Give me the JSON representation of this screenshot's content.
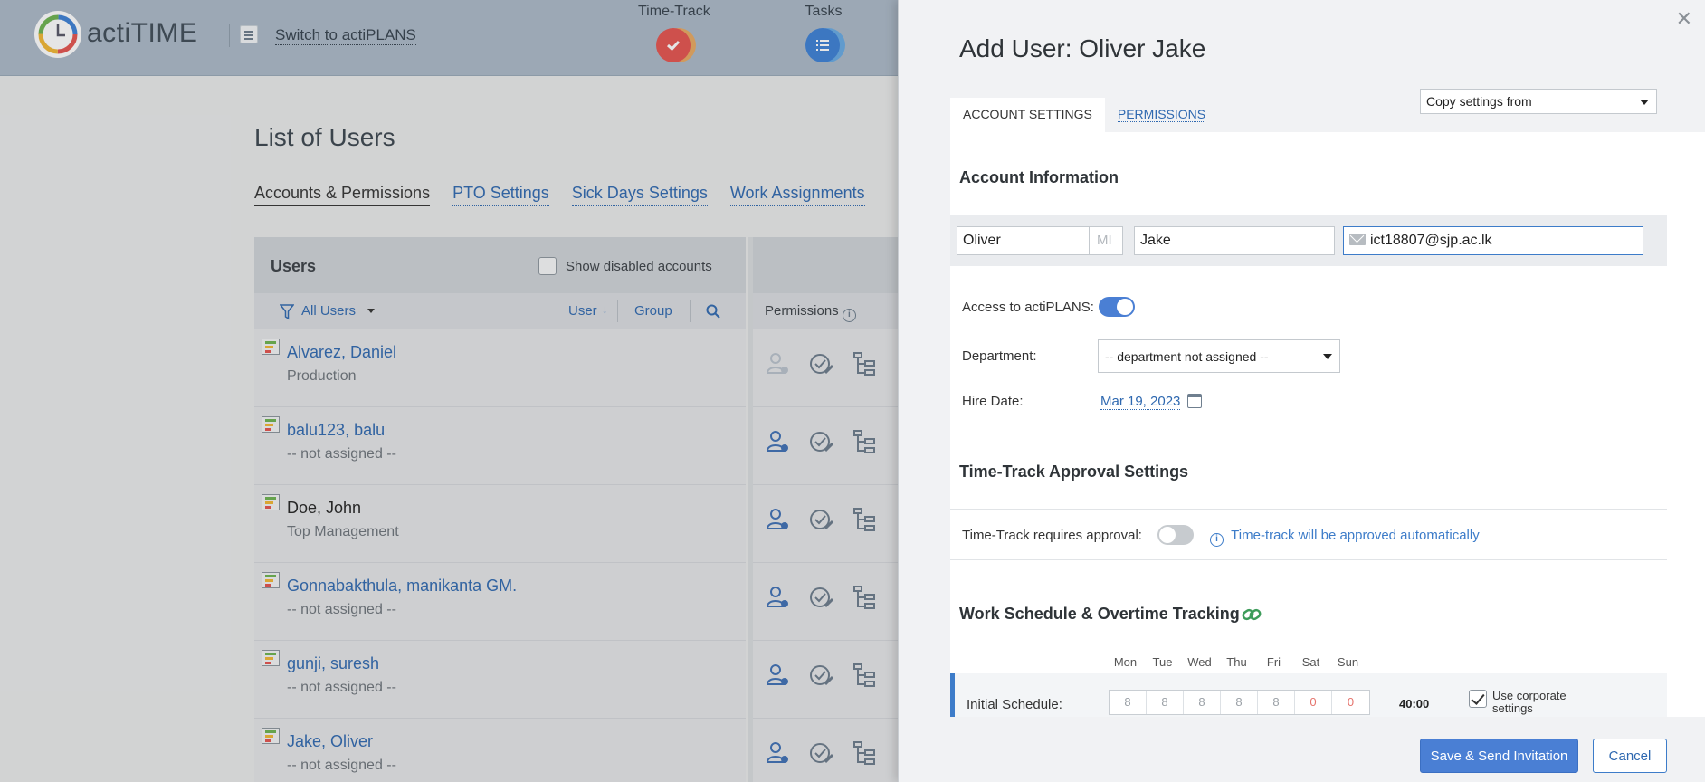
{
  "app": {
    "brand": "actiTIME",
    "switch_link": "Switch to actiPLANS",
    "nav": [
      {
        "label": "Time-Track",
        "icon": "checkmark-icon",
        "color": "#e5524d"
      },
      {
        "label": "Tasks",
        "icon": "list-icon",
        "color": "#3b7fd6"
      }
    ]
  },
  "page": {
    "title": "List of Users",
    "tabs": [
      "Accounts & Permissions",
      "PTO Settings",
      "Sick Days Settings",
      "Work Assignments"
    ],
    "active_tab": "Accounts & Permissions"
  },
  "users_panel": {
    "title": "Users",
    "show_disabled_label": "Show disabled accounts",
    "filter_label": "All Users",
    "sort_user": "User",
    "sort_group": "Group",
    "permissions_label": "Permissions",
    "rows": [
      {
        "name": "Alvarez, Daniel",
        "dept": "Production"
      },
      {
        "name": "balu123, balu",
        "dept": "-- not assigned --"
      },
      {
        "name": "Doe, John",
        "dept": "Top Management"
      },
      {
        "name": "Gonnabakthula, manikanta GM.",
        "dept": "-- not assigned --"
      },
      {
        "name": "gunji, suresh",
        "dept": "-- not assigned --"
      },
      {
        "name": "Jake, Oliver",
        "dept": "-- not assigned --"
      }
    ]
  },
  "modal": {
    "title": "Add User: Oliver Jake",
    "tabs": [
      "ACCOUNT SETTINGS",
      "PERMISSIONS"
    ],
    "active_tab": "ACCOUNT SETTINGS",
    "copy_settings_placeholder": "Copy settings from",
    "account_info": {
      "section_title": "Account Information",
      "first_name": "Oliver",
      "middle_initial_placeholder": "MI",
      "last_name": "Jake",
      "email": "ict18807@sjp.ac.lk"
    },
    "access_actiplans": {
      "label": "Access to actiPLANS:",
      "enabled": true
    },
    "department": {
      "label": "Department:",
      "value": "-- department not assigned --"
    },
    "hire_date": {
      "label": "Hire Date:",
      "value": "Mar 19, 2023"
    },
    "approval": {
      "section_title": "Time-Track Approval Settings",
      "label": "Time-Track requires approval:",
      "enabled": false,
      "note": "Time-track will be approved automatically"
    },
    "schedule": {
      "section_title": "Work Schedule & Overtime Tracking",
      "days": [
        "Mon",
        "Tue",
        "Wed",
        "Thu",
        "Fri",
        "Sat",
        "Sun"
      ],
      "row_label": "Initial Schedule:",
      "hours": [
        "8",
        "8",
        "8",
        "8",
        "8",
        "0",
        "0"
      ],
      "total": "40:00",
      "corporate_label": "Use corporate settings",
      "corporate_checked": true
    },
    "buttons": {
      "save": "Save & Send Invitation",
      "cancel": "Cancel"
    }
  }
}
